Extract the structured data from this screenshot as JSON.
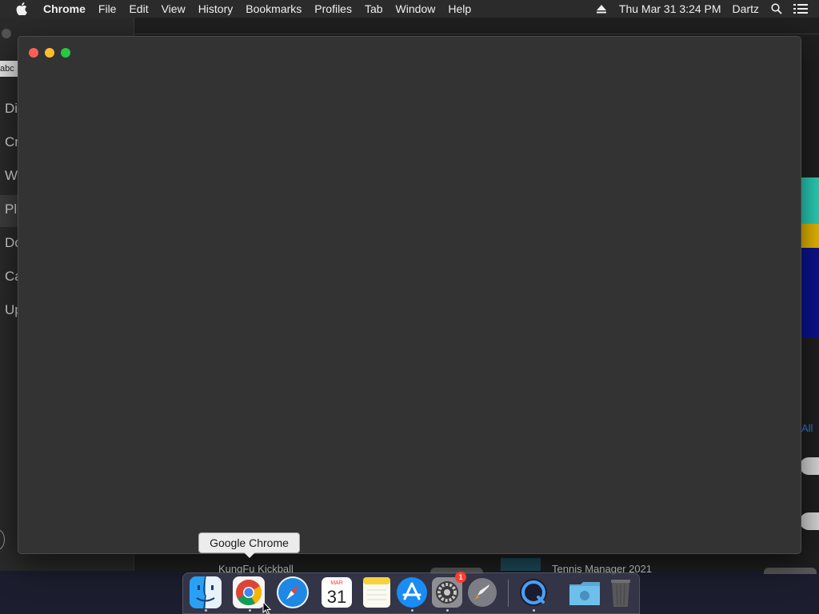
{
  "menubar": {
    "app_name": "Chrome",
    "items": [
      "File",
      "Edit",
      "View",
      "History",
      "Bookmarks",
      "Profiles",
      "Tab",
      "Window",
      "Help"
    ],
    "datetime": "Thu Mar 31  3:24 PM",
    "user": "Dartz"
  },
  "background_app": {
    "search_text": "abc",
    "nav_items": [
      "Di",
      "Cr",
      "W",
      "Pl",
      "Do",
      "Ca",
      "Up"
    ],
    "active_nav_index": 3,
    "see_all_label": "All",
    "row_titles": [
      "KungFu Kickball",
      "Tennis Manager 2021"
    ],
    "art_colors": [
      "#2ad1b8",
      "#e8b800",
      "#0b1390"
    ],
    "link_color": "#2f7cf6"
  },
  "chrome_window": {
    "background": "#333333"
  },
  "dock": {
    "tooltip": "Google Chrome",
    "calendar": {
      "month": "MAR",
      "day": "31"
    },
    "appstore_badge": "1",
    "apps": [
      "finder-icon",
      "chrome-icon",
      "safari-icon",
      "calendar-icon",
      "notes-icon",
      "app-store-icon",
      "system-preferences-icon",
      "rocket-icon",
      "quicktime-icon",
      "downloads-folder-icon",
      "trash-icon"
    ]
  }
}
